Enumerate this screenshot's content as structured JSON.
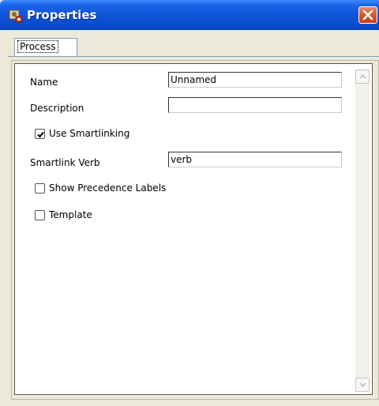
{
  "window": {
    "title": "Properties"
  },
  "tabs": [
    {
      "label": "Process"
    }
  ],
  "form": {
    "name_label": "Name",
    "name_value": "Unnamed",
    "description_label": "Description",
    "description_value": "",
    "use_smartlinking_label": "Use Smartlinking",
    "use_smartlinking_checked": true,
    "smartlink_verb_label": "Smartlink Verb",
    "smartlink_verb_value": "verb",
    "show_precedence_labels_label": "Show Precedence Labels",
    "show_precedence_labels_checked": false,
    "template_label": "Template",
    "template_checked": false
  },
  "colors": {
    "titlebar": "#0f54d8",
    "close": "#d24f25",
    "window_bg": "#ece9d8"
  },
  "icons": {
    "title": "properties-icon",
    "close": "close-icon"
  }
}
